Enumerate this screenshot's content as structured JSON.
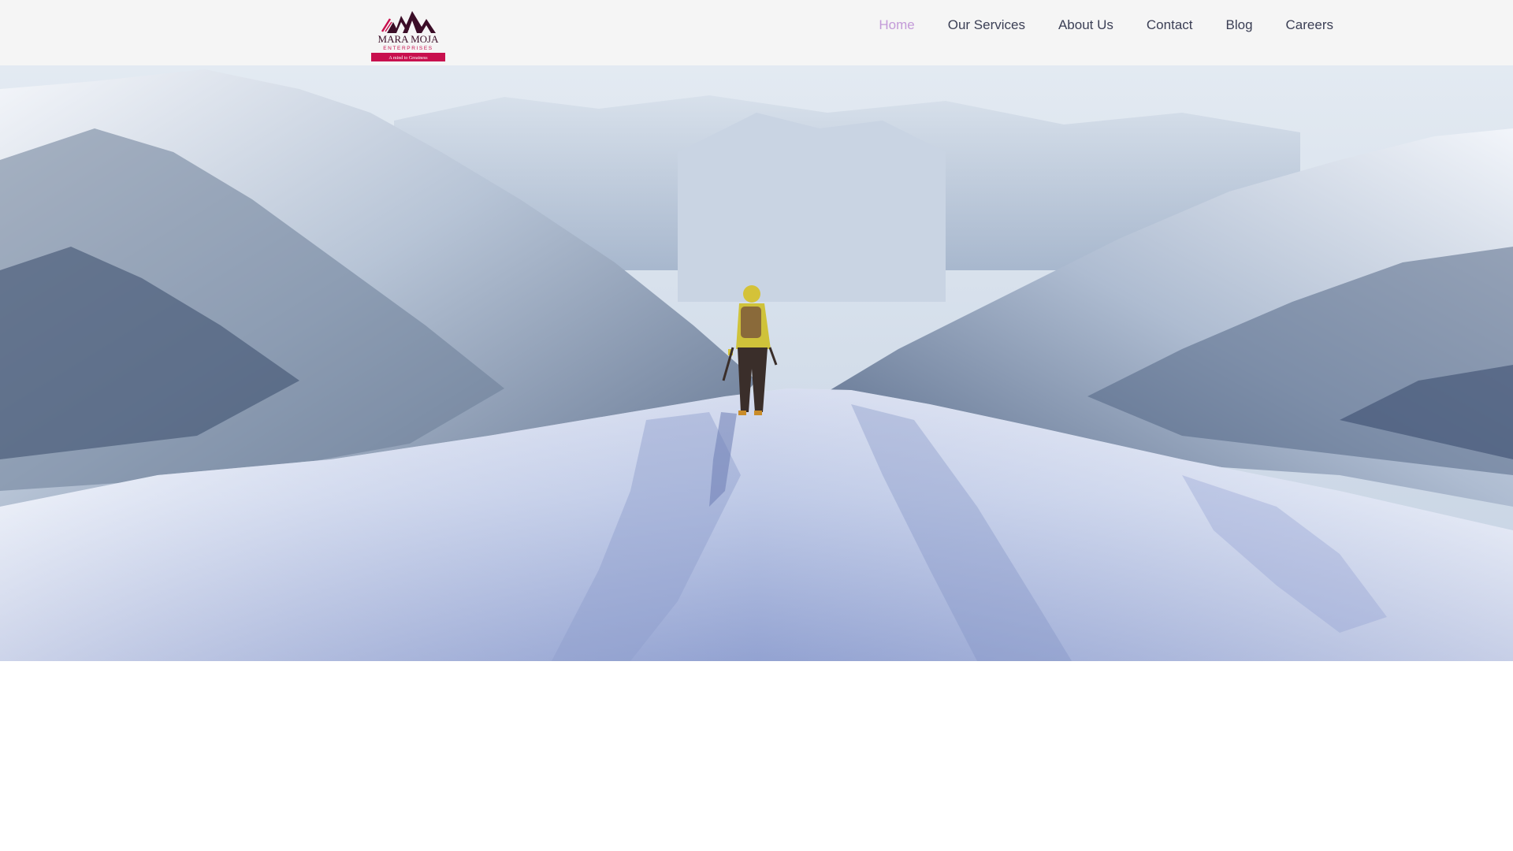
{
  "brand": {
    "name": "MARA MOJA",
    "sub": "ENTERPRISES",
    "tagline": "A mind to Greatness",
    "colors": {
      "dark": "#3b0d27",
      "accent": "#c8104e"
    }
  },
  "nav": {
    "items": [
      {
        "label": "Home",
        "active": true
      },
      {
        "label": "Our Services",
        "active": false
      },
      {
        "label": "About Us",
        "active": false
      },
      {
        "label": "Contact",
        "active": false
      },
      {
        "label": "Blog",
        "active": false
      },
      {
        "label": "Careers",
        "active": false
      }
    ],
    "colors": {
      "default": "#3b3f55",
      "active": "#c39ad8"
    }
  },
  "hero": {
    "image": "snowy-mountain-hiker-photo"
  }
}
